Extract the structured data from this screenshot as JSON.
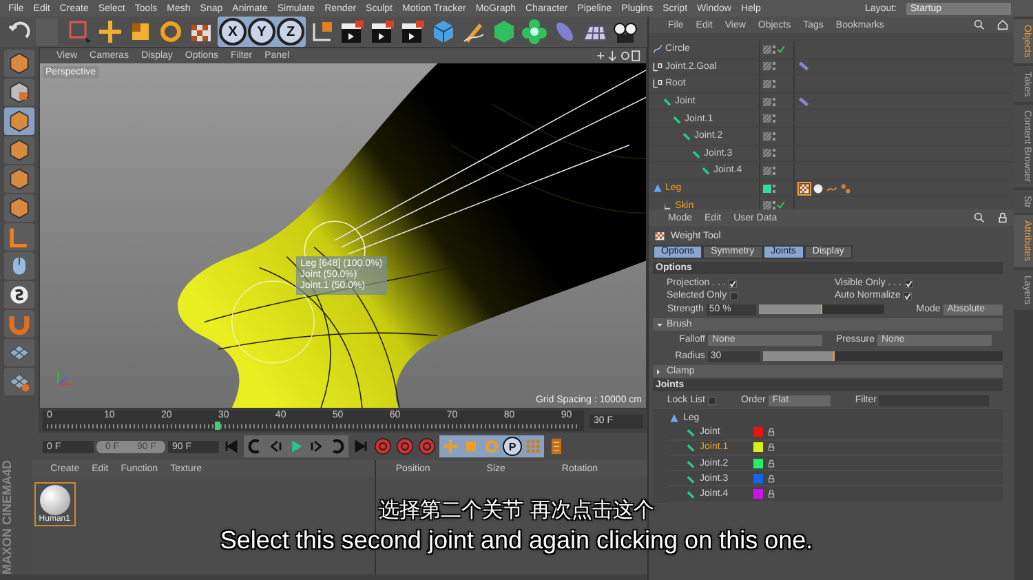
{
  "menu_bar": {
    "items": [
      "File",
      "Edit",
      "Create",
      "Select",
      "Tools",
      "Mesh",
      "Snap",
      "Animate",
      "Simulate",
      "Render",
      "Sculpt",
      "Motion Tracker",
      "MoGraph",
      "Character",
      "Pipeline",
      "Plugins",
      "Script",
      "Window",
      "Help"
    ],
    "layout_label": "Layout:",
    "layout_value": "Startup"
  },
  "toolbar": {
    "axis_buttons": [
      "X",
      "Y",
      "Z"
    ]
  },
  "viewport": {
    "menu": [
      "View",
      "Cameras",
      "Display",
      "Options",
      "Filter",
      "Panel"
    ],
    "camera_label": "Perspective",
    "tooltip": [
      "Leg [648] (100.0%)",
      "Joint (50.0%)",
      "Joint.1 (50.0%)"
    ],
    "grid_spacing": "Grid Spacing : 10000 cm"
  },
  "timeline": {
    "ticks": [
      "0",
      "10",
      "20",
      "30",
      "40",
      "50",
      "60",
      "70",
      "80",
      "90"
    ],
    "level": 0.333,
    "end_field": "30 F",
    "start_field": "0 F",
    "range_start": "0 F",
    "range_end": "90 F",
    "max_field": "90 F",
    "param_button": "P"
  },
  "material_manager": {
    "menu": [
      "Create",
      "Edit",
      "Function",
      "Texture"
    ],
    "materials": [
      {
        "name": "Human1",
        "selected": true
      }
    ]
  },
  "coordinates": {
    "columns": [
      "Position",
      "Size",
      "Rotation"
    ]
  },
  "logo": "MAXON CINEMA4D",
  "object_manager": {
    "menu": [
      "File",
      "Edit",
      "View",
      "Objects",
      "Tags",
      "Bookmarks"
    ],
    "objects": [
      {
        "name": "Circle",
        "kind": "spline",
        "selected": false,
        "checked": true
      },
      {
        "name": "Joint.2.Goal",
        "kind": "null",
        "selected": false,
        "checked": false,
        "tags": [
          {
            "kind": "ik"
          }
        ]
      },
      {
        "name": "Root",
        "kind": "null",
        "selected": false,
        "checked": false,
        "children": [
          {
            "name": "Joint",
            "kind": "joint",
            "selected": false,
            "checked": false,
            "tags": [
              {
                "kind": "ik"
              }
            ],
            "children": [
              {
                "name": "Joint.1",
                "kind": "joint",
                "selected": false,
                "checked": false,
                "children": [
                  {
                    "name": "Joint.2",
                    "kind": "joint",
                    "selected": false,
                    "checked": false,
                    "children": [
                      {
                        "name": "Joint.3",
                        "kind": "joint",
                        "selected": false,
                        "checked": false,
                        "children": [
                          {
                            "name": "Joint.4",
                            "kind": "joint",
                            "selected": false,
                            "checked": false
                          }
                        ]
                      }
                    ]
                  }
                ]
              }
            ]
          }
        ]
      },
      {
        "name": "Leg",
        "kind": "mesh",
        "selected": true,
        "checked": false,
        "color": "#33dd99",
        "tags": [
          {
            "kind": "weight"
          },
          {
            "kind": "material"
          },
          {
            "kind": "vertex"
          },
          {
            "kind": "pose"
          }
        ],
        "children": [
          {
            "name": "Skin",
            "kind": "skin",
            "selected": true,
            "checked": true
          }
        ]
      }
    ]
  },
  "right_tabs": [
    {
      "label": "Objects",
      "selected": true
    },
    {
      "label": "Takes",
      "selected": false
    },
    {
      "label": "Content Browser",
      "selected": false
    },
    {
      "label": "Str",
      "selected": false
    }
  ],
  "attribute_manager": {
    "menu": [
      "Mode",
      "Edit",
      "User Data"
    ],
    "title": "Weight Tool",
    "tabs": [
      {
        "label": "Options",
        "selected": true
      },
      {
        "label": "Symmetry",
        "selected": false
      },
      {
        "label": "Joints",
        "selected": true
      },
      {
        "label": "Display",
        "selected": false
      }
    ],
    "options_heading": "Options",
    "checks": [
      {
        "label": "Projection . . .",
        "checked": true
      },
      {
        "label": "Visible Only . . .",
        "checked": true
      },
      {
        "label": "Selected Only",
        "checked": false
      },
      {
        "label": "Auto Normalize",
        "checked": true
      }
    ],
    "strength": {
      "label": "Strength",
      "value": "50 %",
      "level": 0.5
    },
    "mode": {
      "label": "Mode",
      "value": "Absolute"
    },
    "brush": {
      "title": "Brush",
      "expanded": true
    },
    "falloff": {
      "label": "Falloff",
      "value": "None"
    },
    "pressure": {
      "label": "Pressure",
      "value": "None"
    },
    "radius": {
      "label": "Radius",
      "value": "30",
      "level": 0.3
    },
    "clamp": {
      "title": "Clamp",
      "expanded": false
    },
    "joints_heading": "Joints",
    "lock_list": {
      "label": "Lock List",
      "checked": false
    },
    "order": {
      "label": "Order",
      "value": "Flat"
    },
    "filter": {
      "label": "Filter"
    },
    "joint_root": "Leg",
    "joints": [
      {
        "name": "Joint",
        "color": "#ee1111",
        "selected": false
      },
      {
        "name": "Joint.1",
        "color": "#ddee11",
        "selected": true
      },
      {
        "name": "Joint.2",
        "color": "#22ee66",
        "selected": false
      },
      {
        "name": "Joint.3",
        "color": "#1166ee",
        "selected": false
      },
      {
        "name": "Joint.4",
        "color": "#cc11ee",
        "selected": false
      }
    ]
  },
  "attribute_tabs": [
    {
      "label": "Attributes",
      "selected": true
    },
    {
      "label": "Layers",
      "selected": false
    }
  ],
  "subtitles": [
    "选择第二个关节 再次点击这个",
    "Select this second joint and again clicking on this one."
  ]
}
